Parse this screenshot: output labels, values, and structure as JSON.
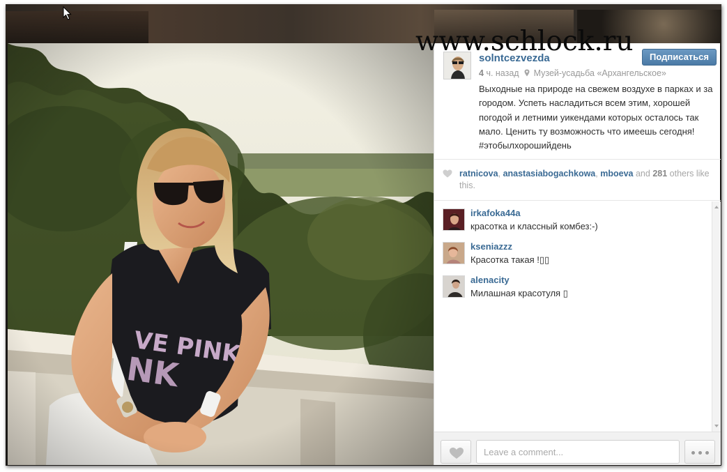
{
  "watermark": "www.schlock.ru",
  "post": {
    "username": "solntcezvezda",
    "follow_label": "Подписаться",
    "time_value": "4",
    "time_unit": "ч. назад",
    "location": "Музей-усадьба «Архангельское»",
    "caption": "Выходные на природе на свежем воздухе в парках и за городом. Успеть насладиться всем этим, хорошей погодой и летними уикендами которых осталось так мало. Ценить ту возможность что имеешь сегодня! #этобылхорошийдень"
  },
  "likes": {
    "user1": "ratnicova",
    "sep1": ",",
    "user2": "anastasiabogachkowa",
    "sep2": ",",
    "user3": "mboeva",
    "and_word": "and",
    "count": "281",
    "suffix": "others like this."
  },
  "comments": [
    {
      "user": "irkafoka44a",
      "text": "красотка и классный комбез:-)"
    },
    {
      "user": "kseniazzz",
      "text": "Красотка такая !▯▯"
    },
    {
      "user": "alenacity",
      "text": "Милашная красотуля ▯"
    }
  ],
  "comment_box": {
    "placeholder": "Leave a comment..."
  },
  "icons": {
    "cursor": "arrow-cursor-icon",
    "location": "location-pin-icon",
    "likes": "heart-icon",
    "like_button": "heart-icon",
    "more": "more-dots-icon"
  },
  "colors": {
    "username": "#3a6a94",
    "follow_button": "#5786b3",
    "text": "#2f2f2f",
    "muted": "#a6a6a6"
  }
}
